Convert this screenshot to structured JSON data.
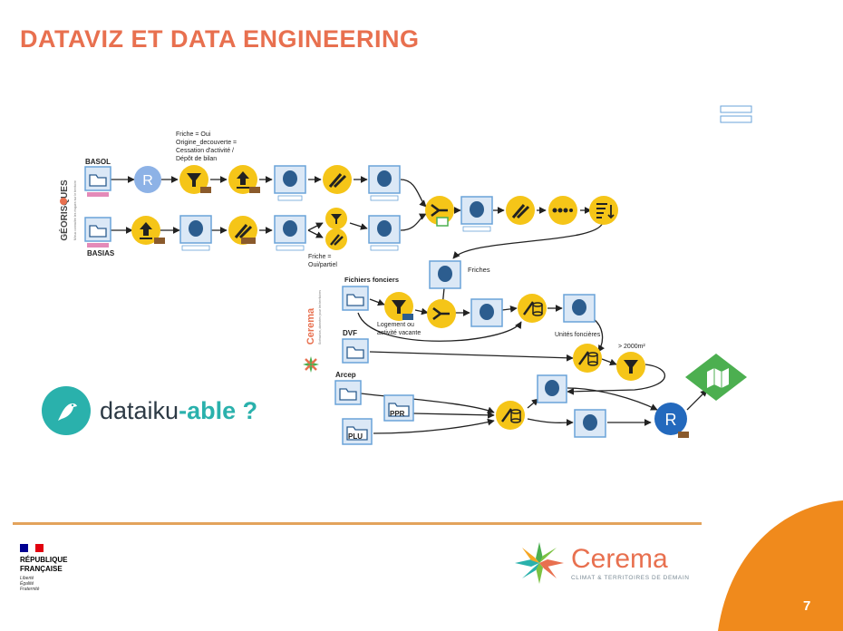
{
  "slide": {
    "title": "DATAVIZ ET DATA ENGINEERING",
    "page_number": "7"
  },
  "diagram": {
    "note_friche": "Friche = Oui\nOrigine_decouverte =\nCessation d'activité /\nDépôt de bilan",
    "label_basol": "BASOL",
    "label_basias": "BASIAS",
    "label_friche_partiel": "Friche =\nOui/partiel",
    "label_friches": "Friches",
    "label_fichiers_fonciers": "Fichiers fonciers",
    "label_logement": "Logement ou\nactivité vacante",
    "label_unites": "Unités foncières",
    "label_dvf": "DVF",
    "label_surface": "> 2000m²",
    "label_arcep": "Arcep",
    "label_ppr": "PPR",
    "label_plu": "PLU",
    "georisques_logo": "GÉORISQUES",
    "georisques_tagline": "Mieux connaître les risques sur le territoire",
    "cerema_side_logo": "Cerema",
    "cerema_side_tagline": "Scénarios, données pour les territoires",
    "colors": {
      "recipe_yellow": "#f5c518",
      "dataset_blue": "#6aa3d8",
      "map_green": "#4caf50",
      "r_blue": "#2369bd"
    }
  },
  "dataiku": {
    "text_main": "dataiku",
    "text_accent": "-able ?"
  },
  "footer": {
    "republique_line1": "RÉPUBLIQUE",
    "republique_line2": "FRANÇAISE",
    "motto": "Liberté\nÉgalité\nFraternité",
    "cerema_name": "Cerema",
    "cerema_tagline": "CLIMAT & TERRITOIRES DE DEMAIN"
  }
}
